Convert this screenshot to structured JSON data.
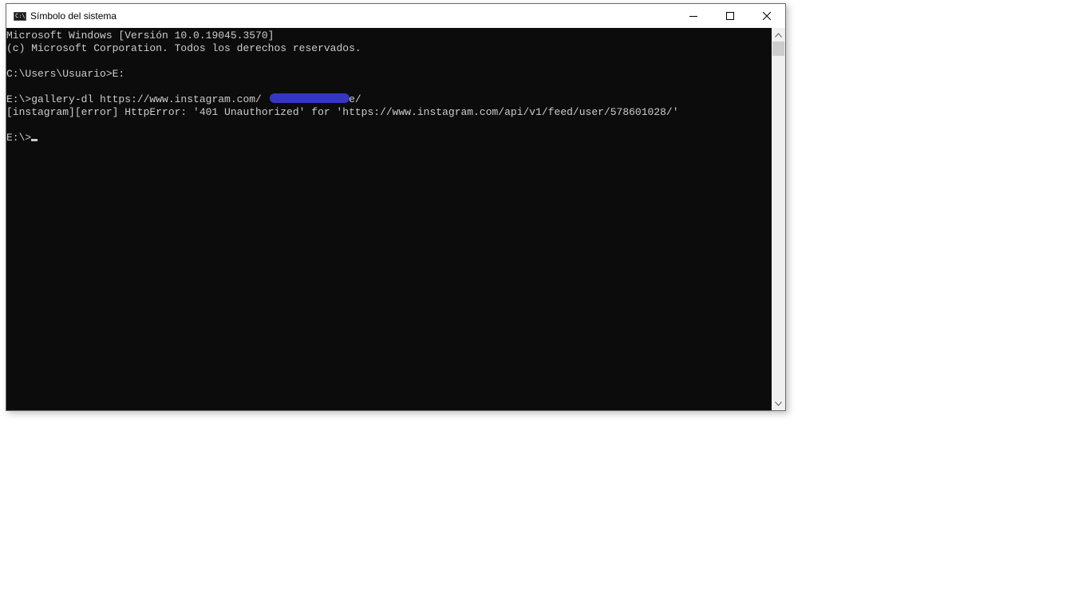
{
  "window": {
    "title": "Símbolo del sistema",
    "app_icon_label": "C:\\",
    "controls": {
      "minimize": "minimize-icon",
      "maximize": "maximize-icon",
      "close": "close-icon"
    }
  },
  "console": {
    "lines": [
      "Microsoft Windows [Versión 10.0.19045.3570]",
      "(c) Microsoft Corporation. Todos los derechos reservados.",
      "",
      "C:\\Users\\Usuario>E:",
      "",
      "E:\\>gallery-dl https://www.instagram.com/              e/",
      "[instagram][error] HttpError: '401 Unauthorized' for 'https://www.instagram.com/api/v1/feed/user/578601028/'",
      "",
      "E:\\>"
    ],
    "redaction_color": "#3b3bd6",
    "text_color": "#cccccc",
    "background_color": "#0c0c0c"
  }
}
